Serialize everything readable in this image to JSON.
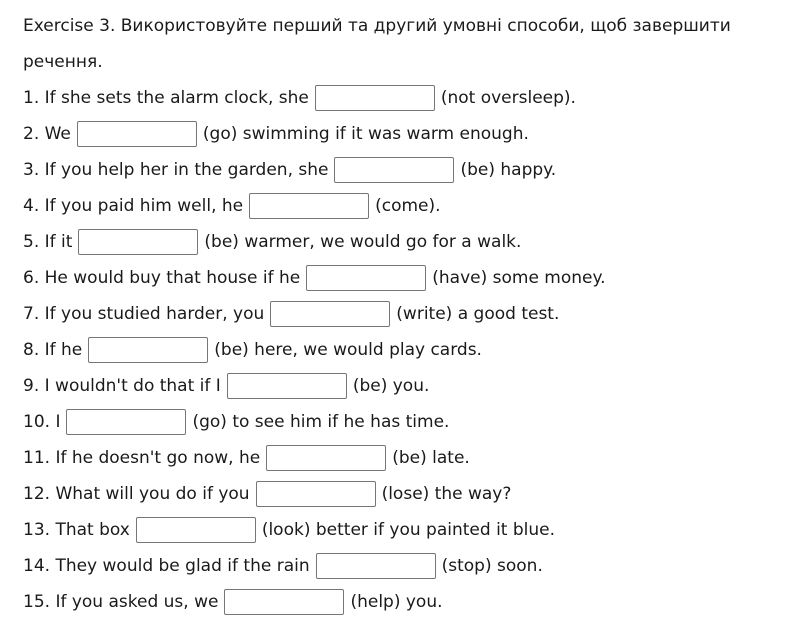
{
  "title": "Exercise 3. Використовуйте перший та другий умовні способи, щоб завершити речення.",
  "items": [
    {
      "before": "1. If she sets the alarm clock, she",
      "after": "(not oversleep).",
      "value": ""
    },
    {
      "before": "2. We",
      "after": "(go) swimming if it was warm enough.",
      "value": ""
    },
    {
      "before": "3. If you help her in the garden, she",
      "after": "(be) happy.",
      "value": ""
    },
    {
      "before": "4. If you paid him well, he",
      "after": "(come).",
      "value": ""
    },
    {
      "before": "5. If it",
      "after": "(be) warmer, we would go for a walk.",
      "value": ""
    },
    {
      "before": "6. He would buy that house if he",
      "after": "(have) some money.",
      "value": ""
    },
    {
      "before": "7. If you studied harder, you",
      "after": "(write) a good test.",
      "value": ""
    },
    {
      "before": "8. If he",
      "after": "(be) here, we would play cards.",
      "value": ""
    },
    {
      "before": "9. I wouldn't do that if I",
      "after": "(be) you.",
      "value": ""
    },
    {
      "before": "10. I",
      "after": "(go) to see him if he has time.",
      "value": ""
    },
    {
      "before": "11. If he doesn't go now, he",
      "after": "(be) late.",
      "value": ""
    },
    {
      "before": "12. What will you do if you",
      "after": "(lose) the way?",
      "value": ""
    },
    {
      "before": "13. That box",
      "after": "(look) better if you painted it blue.",
      "value": ""
    },
    {
      "before": "14. They would be glad if the rain",
      "after": "(stop) soon.",
      "value": ""
    },
    {
      "before": "15. If you asked us, we",
      "after": "(help) you.",
      "value": ""
    }
  ]
}
